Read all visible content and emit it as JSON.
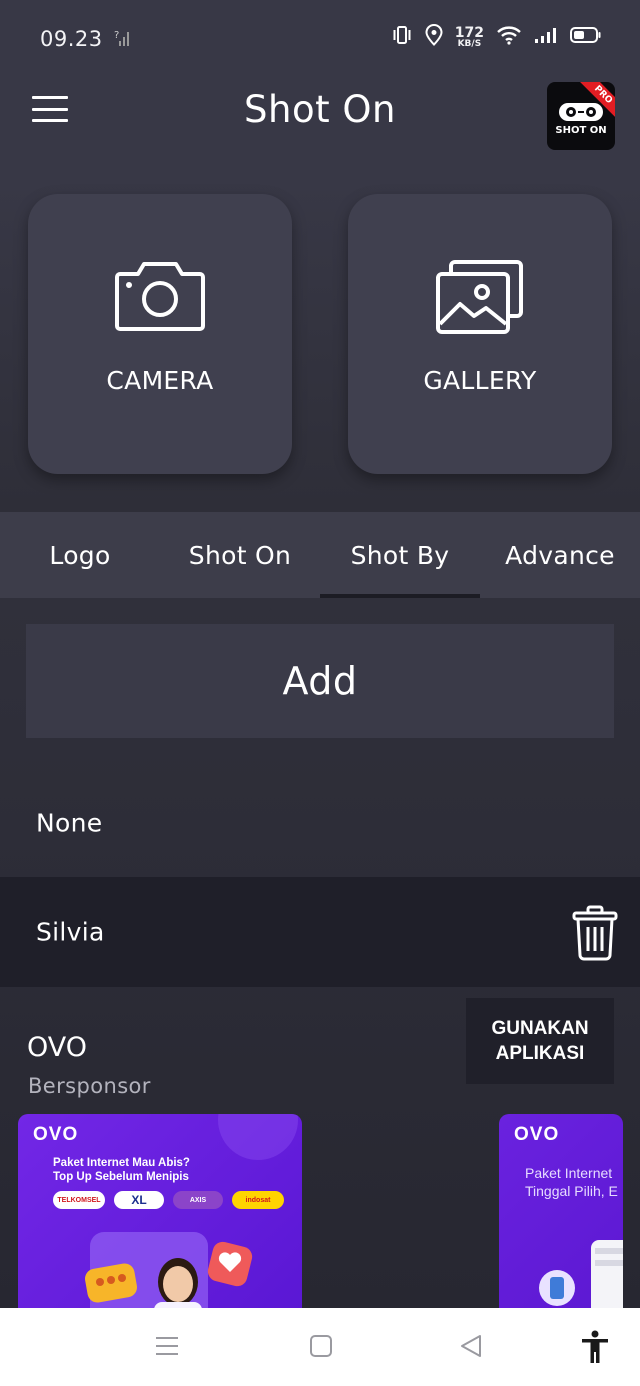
{
  "status_bar": {
    "time": "09.23",
    "net_speed_value": "172",
    "net_speed_unit": "KB/S",
    "icons": [
      "sim-no-signal-icon",
      "vibrate-icon",
      "location-icon",
      "wifi-icon",
      "cell-signal-icon",
      "battery-icon"
    ]
  },
  "header": {
    "title": "Shot On",
    "menu_icon": "hamburger-menu-icon",
    "pro_badge": {
      "ribbon": "PRO",
      "label": "SHOT ON"
    }
  },
  "tiles": [
    {
      "label": "CAMERA",
      "icon": "camera-icon"
    },
    {
      "label": "GALLERY",
      "icon": "gallery-icon"
    }
  ],
  "tabs": [
    {
      "label": "Logo",
      "active": false
    },
    {
      "label": "Shot On",
      "active": false
    },
    {
      "label": "Shot By",
      "active": true
    },
    {
      "label": "Advance",
      "active": false
    }
  ],
  "content": {
    "add_label": "Add",
    "items": [
      {
        "label": "None",
        "selected": false
      },
      {
        "label": "Silvia",
        "selected": true,
        "action_icon": "trash-icon"
      }
    ]
  },
  "ad": {
    "advertiser": "OVO",
    "sponsored_label": "Bersponsor",
    "cta_line1": "GUNAKAN",
    "cta_line2": "APLIKASI",
    "card1": {
      "brand": "OVO",
      "headline_1": "Paket Internet Mau Abis?",
      "headline_2": "Top Up Sebelum Menipis",
      "operators": [
        "TELKOMSEL",
        "XL",
        "AXIS",
        "indosat"
      ]
    },
    "card2": {
      "brand": "OVO",
      "headline_1": "Paket Internet",
      "headline_2": "Tinggal Pilih, E"
    }
  },
  "colors": {
    "background": "#2a2a34",
    "header": "#383846",
    "tile": "#40404f",
    "tab_bar": "#3d3d4a",
    "selected_row": "#1f1f29",
    "ad_purple": "#6b1fe0",
    "pro_red": "#e21d23"
  },
  "nav_bar": {
    "icons": [
      "recents-icon",
      "home-icon",
      "back-icon",
      "accessibility-icon"
    ]
  }
}
